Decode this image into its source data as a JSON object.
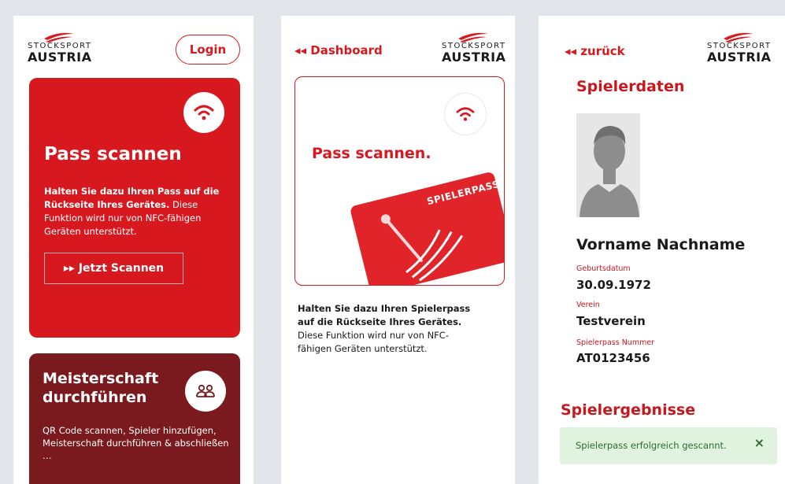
{
  "brand": {
    "logo_top": "STOCKSPORT",
    "logo_bottom": "AUSTRIA",
    "primary_color": "#d7191f",
    "dark_color": "#7a1a1e"
  },
  "screen1": {
    "login_label": "Login",
    "scan_card": {
      "title": "Pass scannen",
      "desc_bold": "Halten Sie dazu Ihren Pass auf die Rückseite Ihres Gerätes.",
      "desc_rest": " Diese Funktion wird nur von NFC-fähigen Geräten unterstützt.",
      "button_label": "▸▸ Jetzt Scannen",
      "icon": "nfc-wifi-icon"
    },
    "meister_card": {
      "title": "Meisterschaft durchführen",
      "desc": "QR Code scannen, Spieler hinzufügen, Meisterschaft durchführen & abschließen …",
      "icon": "people-icon"
    }
  },
  "screen2": {
    "back_label": "◂◂ Dashboard",
    "title": "Pass scannen.",
    "card_label": "SPIELERPASS",
    "desc_bold": "Halten Sie dazu Ihren Spielerpass auf die Rückseite Ihres Gerätes.",
    "desc_rest": " Diese Funktion wird nur von NFC-fähigen Geräten unterstützt."
  },
  "screen3": {
    "back_label": "◂◂ zurück",
    "section_title": "Spielerdaten",
    "player_name": "Vorname Nachname",
    "fields": [
      {
        "label": "Geburtsdatum",
        "value": "30.09.1972"
      },
      {
        "label": "Verein",
        "value": "Testverein"
      },
      {
        "label": "Spielerpass Nummer",
        "value": "AT0123456"
      }
    ],
    "results_title": "Spielergebnisse",
    "toast": {
      "message": "Spielerpass erfolgreich gescannt.",
      "close": "×"
    }
  }
}
